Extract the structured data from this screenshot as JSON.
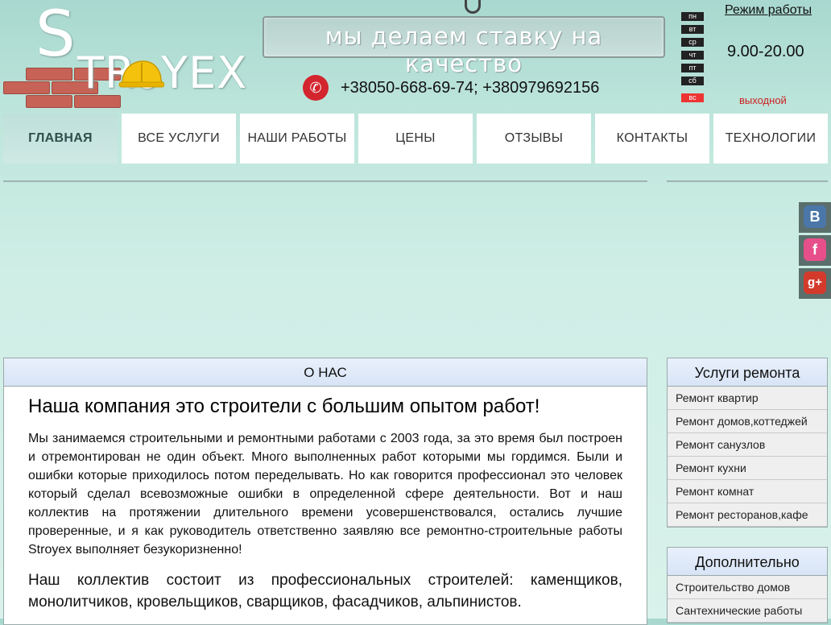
{
  "logo": {
    "big_letter": "S",
    "rest": "TRoYEX"
  },
  "slogan": "мы делаем ставку на качество",
  "phone": "+38050-668-69-74; +380979692156",
  "schedule": {
    "title": "Режим работы",
    "days": [
      "пн",
      "вт",
      "ср",
      "чт",
      "пт",
      "сб"
    ],
    "off_day": "вс",
    "hours": "9.00-20.00",
    "off_label": "выходной"
  },
  "nav": [
    {
      "label": "ГЛАВНАЯ"
    },
    {
      "label": "ВСЕ УСЛУГИ"
    },
    {
      "label": "НАШИ РАБОТЫ"
    },
    {
      "label": "ЦЕНЫ"
    },
    {
      "label": "ОТЗЫВЫ"
    },
    {
      "label": "КОНТАКТЫ"
    },
    {
      "label": "ТЕХНОЛОГИИ"
    }
  ],
  "social": [
    {
      "icon": "vk-icon",
      "glyph": "В",
      "color": "#4a76a8"
    },
    {
      "icon": "facebook-icon",
      "glyph": "f",
      "color": "#e64f8a"
    },
    {
      "icon": "google-plus-icon",
      "glyph": "g+",
      "color": "#d33a2c"
    }
  ],
  "about": {
    "header": "О НАС",
    "title": "Наша компания это строители с большим опытом работ!",
    "paragraph1": "Мы занимаемся строительными и ремонтными работами с 2003 года, за это время был построен и отремонтирован не один объект. Много выполненных работ которыми мы гордимся. Были и ошибки которые приходилось потом переделывать. Но как говорится профессионал это человек который сделал всевозможные ошибки в определенной сфере деятельности. Вот и наш коллектив на протяжении длительного времени усовершенствовался, остались лучшие проверенные, и я как руководитель ответственно заявляю все ремонтно-строительные работы Stroyex выполняет безукоризненно!",
    "paragraph2": "Наш коллектив состоит из профессиональных строителей: каменщиков, монолитчиков, кровельщиков, сварщиков, фасадчиков, альпинистов."
  },
  "sidebar_repair": {
    "title": "Услуги ремонта",
    "items": [
      {
        "label": "Ремонт квартир"
      },
      {
        "label": "Ремонт домов,коттеджей"
      },
      {
        "label": "Ремонт санузлов"
      },
      {
        "label": "Ремонт кухни"
      },
      {
        "label": "Ремонт комнат"
      },
      {
        "label": "Ремонт ресторанов,кафе"
      }
    ]
  },
  "sidebar_extra": {
    "title": "Дополнительно",
    "items": [
      {
        "label": "Строительство домов"
      },
      {
        "label": "Сантехнические работы"
      }
    ]
  }
}
